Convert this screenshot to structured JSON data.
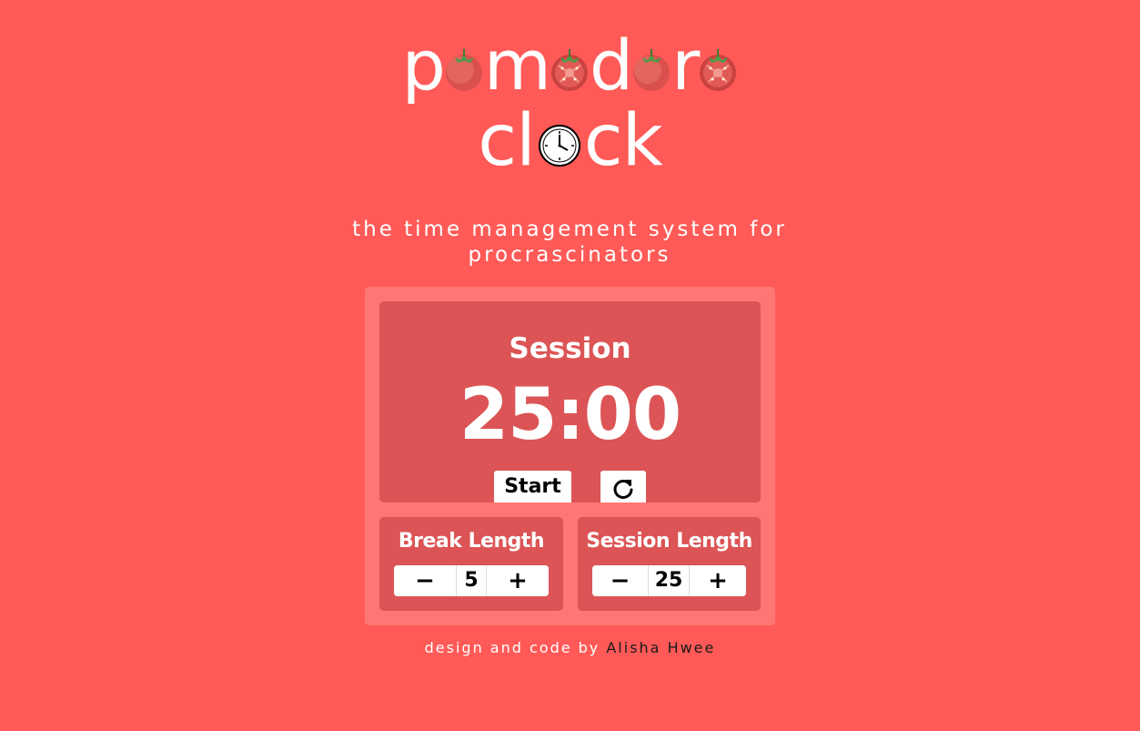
{
  "logo": {
    "line1_letters": [
      "p",
      "m",
      "d",
      "r"
    ],
    "line2_prefix": "cl",
    "line2_suffix": "ck",
    "tomato_icons": [
      "tomato-whole-icon",
      "tomato-half-icon",
      "tomato-whole-icon",
      "tomato-half-icon"
    ],
    "clock_icon": "clock-icon"
  },
  "tagline": "the time management system for procrascinators",
  "timer": {
    "label": "Session",
    "display": "25:00",
    "start_label": "Start",
    "reset_icon": "reset-icon"
  },
  "break_length": {
    "title": "Break Length",
    "decrement_label": "−",
    "value": "5",
    "increment_label": "+"
  },
  "session_length": {
    "title": "Session Length",
    "decrement_label": "−",
    "value": "25",
    "increment_label": "+"
  },
  "footer": {
    "prefix": "design and code by ",
    "author": "Alisha Hwee"
  },
  "colors": {
    "background": "#ff5a57",
    "panel": "#ff7774",
    "box": "#dc5455",
    "text": "#ffffff"
  }
}
